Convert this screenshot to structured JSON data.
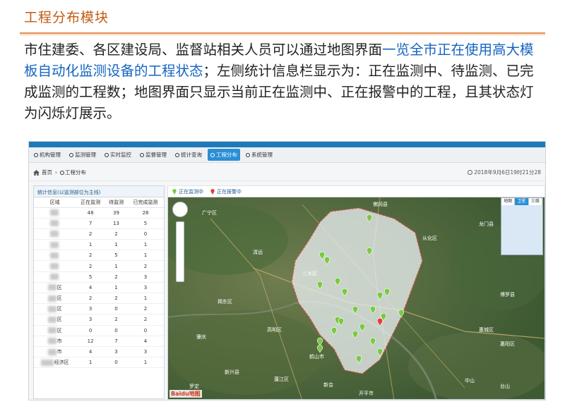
{
  "slide": {
    "title": "工程分布模块",
    "desc_before": "市住建委、各区建设局、监督站相关人员可以通过地图界面",
    "desc_highlight": "一览全市正在使用高大模板自动化监测设备的工程状态",
    "desc_after": "；左侧统计信息栏显示为：正在监测中、待监测、已完成监测的工程数；地图界面只显示当前正在监测中、正在报警中的工程，且其状态灯为闪烁灯展示。"
  },
  "app": {
    "nav": [
      {
        "label": "机构管理",
        "active": false
      },
      {
        "label": "监测管理",
        "active": false
      },
      {
        "label": "实时监控",
        "active": false
      },
      {
        "label": "监督管理",
        "active": false
      },
      {
        "label": "统计查询",
        "active": false
      },
      {
        "label": "工程分布",
        "active": true
      },
      {
        "label": "系统管理",
        "active": false
      }
    ],
    "breadcrumb": {
      "home": "首页",
      "sep": "›",
      "current": "工程分布"
    },
    "clock": "2018年9月6日19时21分28",
    "stats": {
      "title": "统计信息(以监测部位为主线)",
      "headers": [
        "区域",
        "正在监测",
        "待监测",
        "已完成监测"
      ],
      "rows": [
        {
          "region": "",
          "a": "48",
          "b": "39",
          "c": "28"
        },
        {
          "region": "",
          "a": "7",
          "b": "13",
          "c": "5"
        },
        {
          "region": "",
          "a": "2",
          "b": "2",
          "c": "0"
        },
        {
          "region": "",
          "a": "1",
          "b": "1",
          "c": "1"
        },
        {
          "region": "",
          "a": "2",
          "b": "5",
          "c": "1"
        },
        {
          "region": "",
          "a": "2",
          "b": "1",
          "c": "2"
        },
        {
          "region": "",
          "a": "5",
          "b": "2",
          "c": "3"
        },
        {
          "region": "区",
          "a": "4",
          "b": "1",
          "c": "3"
        },
        {
          "region": "区",
          "a": "2",
          "b": "2",
          "c": "1"
        },
        {
          "region": "区",
          "a": "3",
          "b": "0",
          "c": "2"
        },
        {
          "region": "区",
          "a": "3",
          "b": "2",
          "c": "2"
        },
        {
          "region": "区",
          "a": "0",
          "b": "0",
          "c": "0"
        },
        {
          "region": "市",
          "a": "12",
          "b": "7",
          "c": "4"
        },
        {
          "region": "市",
          "a": "4",
          "b": "3",
          "c": "3"
        },
        {
          "region": "经济区",
          "a": "1",
          "b": "0",
          "c": "1"
        }
      ]
    },
    "legend": {
      "monitoring": "正在监测中",
      "alarming": "正在报警中"
    },
    "colors": {
      "monitoring": "#7ac943",
      "alarming": "#e83a3a",
      "accent": "#2a8fd4"
    },
    "map": {
      "labels": [
        "广宁区",
        "揭东区",
        "鹤山市",
        "新会",
        "三水区",
        "肇庆",
        "罗定",
        "惠阳区",
        "惠城区",
        "龙门县",
        "佛冈县",
        "博罗县",
        "从化区",
        "清远",
        "高明区",
        "新兴县",
        "开平市",
        "台山",
        "中山",
        "蓬江区"
      ],
      "minimap_tabs": [
        "地图",
        "卫星",
        "三维"
      ],
      "logo": "Baidu地图"
    }
  }
}
